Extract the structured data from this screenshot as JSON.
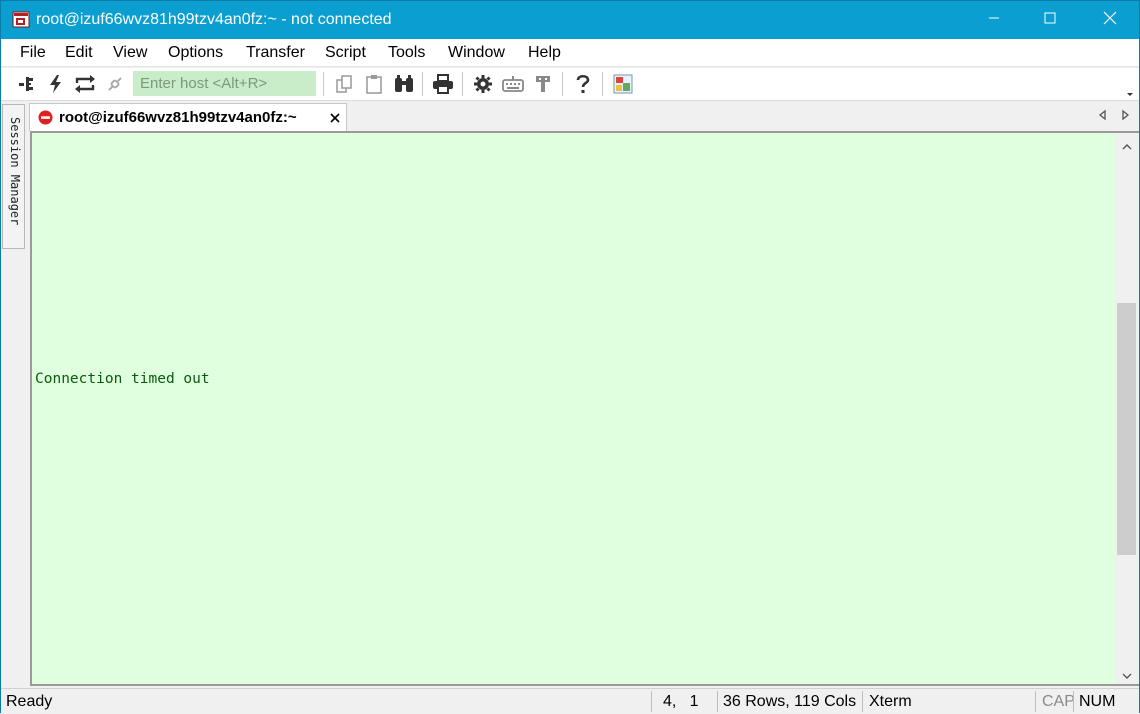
{
  "window": {
    "title": "root@izuf66wvz81h99tzv4an0fz:~ - not connected",
    "title_bar_color": "#0a9fd0"
  },
  "menu": {
    "items": [
      "File",
      "Edit",
      "View",
      "Options",
      "Transfer",
      "Script",
      "Tools",
      "Window",
      "Help"
    ]
  },
  "toolbar": {
    "host_placeholder": "Enter host <Alt+R>",
    "icons": [
      "connect-icon",
      "quick-connect-icon",
      "reconnect-icon",
      "disconnect-icon",
      "copy-icon",
      "paste-icon",
      "find-icon",
      "print-icon",
      "settings-icon",
      "keymap-icon",
      "sftp-icon",
      "help-icon",
      "screenshot-icon"
    ]
  },
  "side_panel": {
    "label": "Session Manager"
  },
  "tabs": [
    {
      "label": "root@izuf66wvz81h99tzv4an0fz:~",
      "status": "disconnected"
    }
  ],
  "terminal": {
    "background": "#dfffdf",
    "text_color": "#0a5a10",
    "lines": [
      "Connection timed out"
    ]
  },
  "status": {
    "ready": "Ready",
    "cursor": "4,   1",
    "size": "36 Rows, 119 Cols",
    "terminal_type": "Xterm",
    "cap": "CAP",
    "num": "NUM"
  }
}
